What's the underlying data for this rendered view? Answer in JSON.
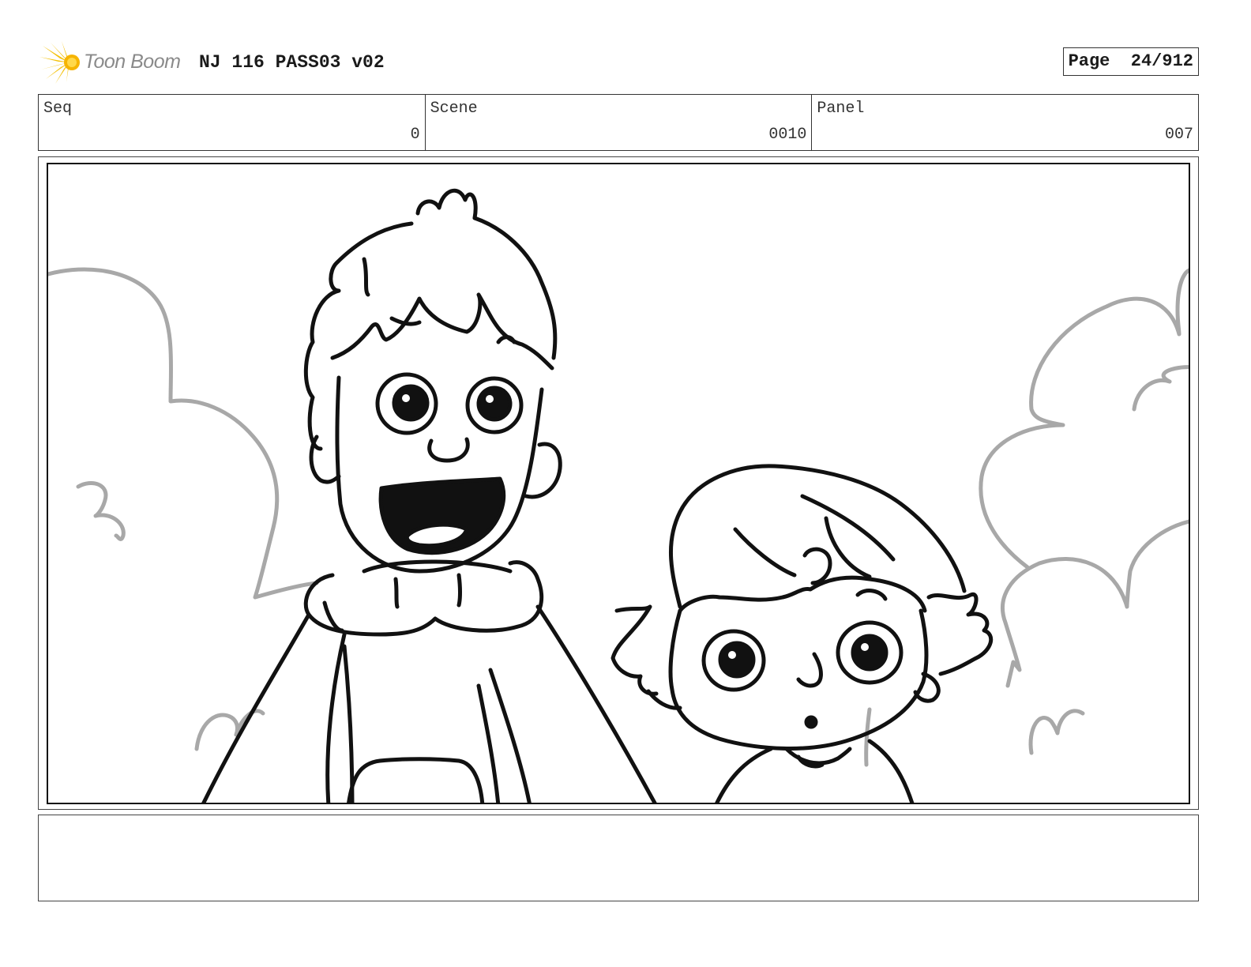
{
  "header": {
    "logo_text": "Toon Boom",
    "title": "NJ 116 PASS03 v02",
    "page_label": "Page",
    "page_value": "24/912"
  },
  "info": {
    "seq": {
      "label": "Seq",
      "value": "0"
    },
    "scene": {
      "label": "Scene",
      "value": "0010"
    },
    "panel": {
      "label": "Panel",
      "value": "007"
    }
  },
  "notes": {
    "text": ""
  },
  "colors": {
    "ink": "#111111",
    "background_lines": "#a8a8a8",
    "logo_sun": "#f4c20d"
  },
  "icons": {
    "logo": "toon-boom-sun-icon"
  }
}
